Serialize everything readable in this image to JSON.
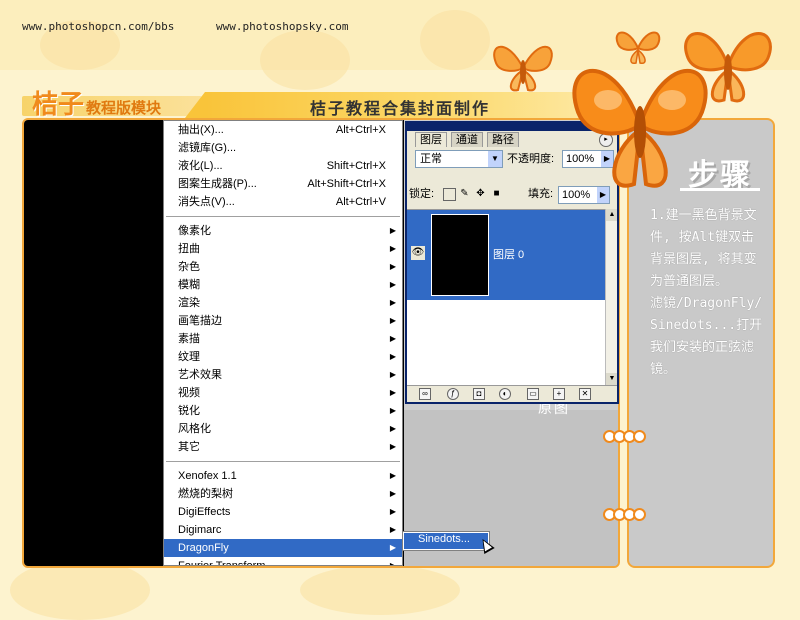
{
  "urls": {
    "left": "www.photoshopcn.com/bbs",
    "right": "www.photoshopsky.com"
  },
  "header": {
    "brand": "桔子",
    "brand_sub": "教程版模块",
    "page_title": "桔子教程合集封面制作"
  },
  "menu": {
    "groups": [
      [
        {
          "label": "抽出(X)...",
          "shortcut": "Alt+Ctrl+X"
        },
        {
          "label": "滤镜库(G)...",
          "shortcut": ""
        },
        {
          "label": "液化(L)...",
          "shortcut": "Shift+Ctrl+X"
        },
        {
          "label": "图案生成器(P)...",
          "shortcut": "Alt+Shift+Ctrl+X"
        },
        {
          "label": "消失点(V)...",
          "shortcut": "Alt+Ctrl+V"
        }
      ],
      [
        {
          "label": "像素化",
          "submenu": true
        },
        {
          "label": "扭曲",
          "submenu": true
        },
        {
          "label": "杂色",
          "submenu": true
        },
        {
          "label": "模糊",
          "submenu": true
        },
        {
          "label": "渲染",
          "submenu": true
        },
        {
          "label": "画笔描边",
          "submenu": true
        },
        {
          "label": "素描",
          "submenu": true
        },
        {
          "label": "纹理",
          "submenu": true
        },
        {
          "label": "艺术效果",
          "submenu": true
        },
        {
          "label": "视频",
          "submenu": true
        },
        {
          "label": "锐化",
          "submenu": true
        },
        {
          "label": "风格化",
          "submenu": true
        },
        {
          "label": "其它",
          "submenu": true
        }
      ],
      [
        {
          "label": " Xenofex 1.1",
          "submenu": true
        },
        {
          "label": " 燃烧的梨树",
          "submenu": true
        },
        {
          "label": "DigiEffects",
          "submenu": true
        },
        {
          "label": "Digimarc",
          "submenu": true
        },
        {
          "label": "DragonFly",
          "submenu": true,
          "selected": true
        },
        {
          "label": "Fourier Transform",
          "submenu": true
        }
      ]
    ]
  },
  "submenu": {
    "item": "Sinedots..."
  },
  "layers_panel": {
    "tabs": [
      "图层",
      "通道",
      "路径"
    ],
    "active_tab": "图层",
    "blend_mode": "正常",
    "opacity_label": "不透明度:",
    "opacity_value": "100%",
    "lock_label": "锁定:",
    "fill_label": "填充:",
    "fill_value": "100%",
    "layer_name": "图层 0"
  },
  "canvas": {
    "caption": "原图"
  },
  "steps": {
    "title": "步骤",
    "text": "1.建一黑色背景文件, 按Alt键双击背景图层, 将其变为普通图层。\n滤镜/DragonFly/Sinedots...打开我们安装的正弦滤镜。"
  },
  "colors": {
    "accent_orange": "#f08a1c",
    "menu_selection": "#316ac5",
    "page_background": "#fdf3cf",
    "panel_gray": "#c9c9c9"
  }
}
